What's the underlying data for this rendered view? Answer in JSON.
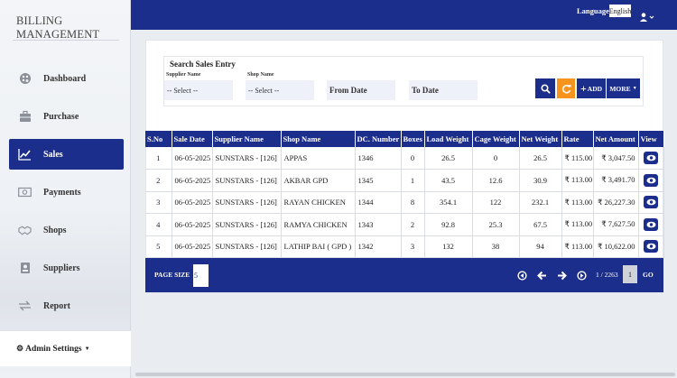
{
  "brand": "BILLING MANAGEMENT",
  "sidebar": {
    "items": [
      {
        "label": "Dashboard",
        "icon": "palette-icon"
      },
      {
        "label": "Purchase",
        "icon": "briefcase-icon"
      },
      {
        "label": "Sales",
        "icon": "trend-chart-icon",
        "active": true
      },
      {
        "label": "Payments",
        "icon": "money-icon"
      },
      {
        "label": "Shops",
        "icon": "handshake-icon"
      },
      {
        "label": "Suppliers",
        "icon": "id-card-icon"
      },
      {
        "label": "Report",
        "icon": "exchange-icon"
      }
    ],
    "admin": "Admin Settings"
  },
  "topbar": {
    "language_label": "Language",
    "language_value": "English"
  },
  "search": {
    "title": "Search Sales Entry",
    "supplier_label": "Supplier Name",
    "supplier_value": "-- Select --",
    "shop_label": "Shop Name",
    "shop_value": "-- Select --",
    "from_date": "From Date",
    "to_date": "To Date",
    "add_label": "ADD",
    "more_label": "MORE"
  },
  "table": {
    "headers": [
      "S.No",
      "Sale Date",
      "Supplier Name",
      "Shop Name",
      "DC. Number",
      "Boxes",
      "Load Weight",
      "Cage Weight",
      "Net Weight",
      "Rate",
      "Net Amount",
      "View"
    ],
    "rows": [
      {
        "sno": "1",
        "date": "06-05-2025",
        "supplier": "SUNSTARS - [126]",
        "shop": "APPAS",
        "dc": "1346",
        "boxes": "0",
        "load": "26.5",
        "cage": "0",
        "net": "26.5",
        "rate": "₹ 115.00",
        "amount": "₹ 3,047.50"
      },
      {
        "sno": "2",
        "date": "06-05-2025",
        "supplier": "SUNSTARS - [126]",
        "shop": "AKBAR GPD",
        "dc": "1345",
        "boxes": "1",
        "load": "43.5",
        "cage": "12.6",
        "net": "30.9",
        "rate": "₹ 113.00",
        "amount": "₹ 3,491.70"
      },
      {
        "sno": "3",
        "date": "06-05-2025",
        "supplier": "SUNSTARS - [126]",
        "shop": "RAYAN CHICKEN",
        "dc": "1344",
        "boxes": "8",
        "load": "354.1",
        "cage": "122",
        "net": "232.1",
        "rate": "₹ 113.00",
        "amount": "₹ 26,227.30"
      },
      {
        "sno": "4",
        "date": "06-05-2025",
        "supplier": "SUNSTARS - [126]",
        "shop": "RAMYA CHICKEN",
        "dc": "1343",
        "boxes": "2",
        "load": "92.8",
        "cage": "25.3",
        "net": "67.5",
        "rate": "₹ 113.00",
        "amount": "₹ 7,627.50"
      },
      {
        "sno": "5",
        "date": "06-05-2025",
        "supplier": "SUNSTARS - [126]",
        "shop": "LATHIP BAI ( GPD )",
        "dc": "1342",
        "boxes": "3",
        "load": "132",
        "cage": "38",
        "net": "94",
        "rate": "₹ 113.00",
        "amount": "₹ 10,622.00"
      }
    ]
  },
  "pager": {
    "size_label": "PAGE SIZE",
    "size_value": "5",
    "info": "1 / 2263",
    "current": "1",
    "go_label": "GO"
  },
  "colors": {
    "primary": "#1c2e8c",
    "search_button": "#1c2e8c",
    "refresh_button": "#f7941d"
  }
}
